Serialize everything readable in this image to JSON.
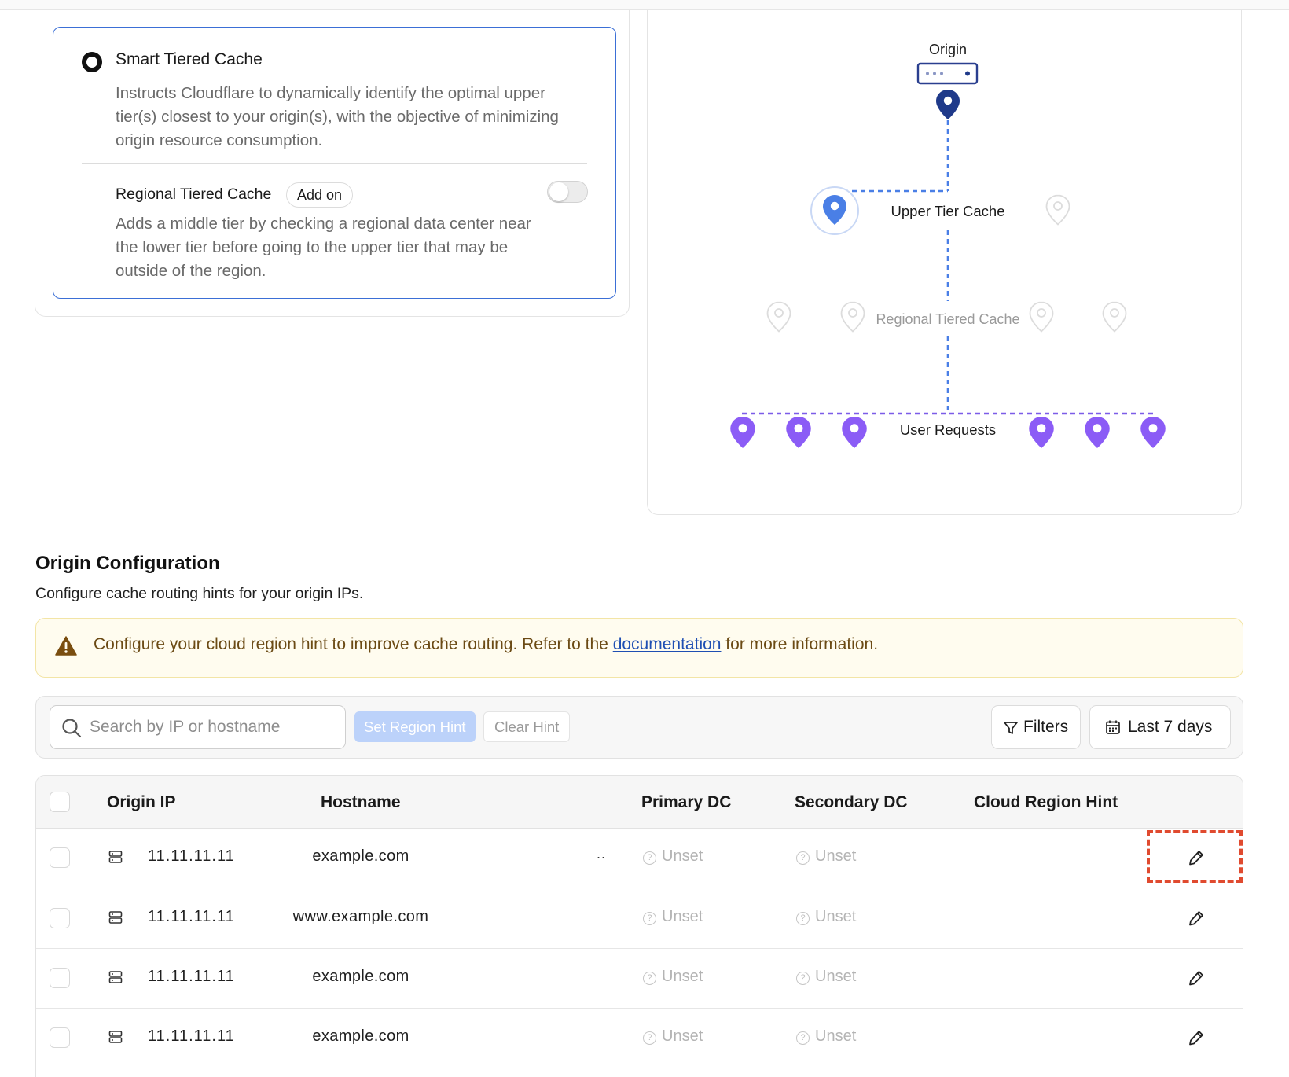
{
  "smart_option": {
    "title": "Smart Tiered Cache",
    "description": "Instructs Cloudflare to dynamically identify the optimal upper tier(s) closest to your origin(s), with the objective of minimizing origin resource consumption."
  },
  "regional_option": {
    "title": "Regional Tiered Cache",
    "badge": "Add on",
    "description": "Adds a middle tier by checking a regional data center near the lower tier before going to the upper tier that may be outside of the region.",
    "enabled": false
  },
  "diagram": {
    "origin_label": "Origin",
    "upper_label": "Upper Tier Cache",
    "regional_label": "Regional Tiered Cache",
    "user_label": "User Requests"
  },
  "origin_config": {
    "title": "Origin Configuration",
    "subtitle": "Configure cache routing hints for your origin IPs."
  },
  "alert": {
    "text_before": "Configure your cloud region hint to improve cache routing. Refer to the ",
    "link": "documentation",
    "text_after": " for more information."
  },
  "toolbar": {
    "search_placeholder": "Search by IP or hostname",
    "set_hint": "Set Region Hint",
    "clear_hint": "Clear Hint",
    "filters": "Filters",
    "date_range": "Last 7 days"
  },
  "table": {
    "headers": {
      "origin_ip": "Origin IP",
      "hostname": "Hostname",
      "primary_dc": "Primary DC",
      "secondary_dc": "Secondary DC",
      "cloud_region_hint": "Cloud Region Hint"
    },
    "rows": [
      {
        "ip": "11.11.11.11",
        "hostname": "example.com",
        "primary": "Unset",
        "secondary": "Unset",
        "more": ".."
      },
      {
        "ip": "11.11.11.11",
        "hostname": "www.example.com",
        "primary": "Unset",
        "secondary": "Unset"
      },
      {
        "ip": "11.11.11.11",
        "hostname": "example.com",
        "primary": "Unset",
        "secondary": "Unset"
      },
      {
        "ip": "11.11.11.11",
        "hostname": "example.com",
        "primary": "Unset",
        "secondary": "Unset"
      }
    ]
  },
  "colors": {
    "accent_blue": "#3b6fd6",
    "origin_pin": "#1f3a8a",
    "upper_pin": "#4a7fe6",
    "user_pin": "#8b5cf6",
    "highlight": "#e04a2f"
  }
}
